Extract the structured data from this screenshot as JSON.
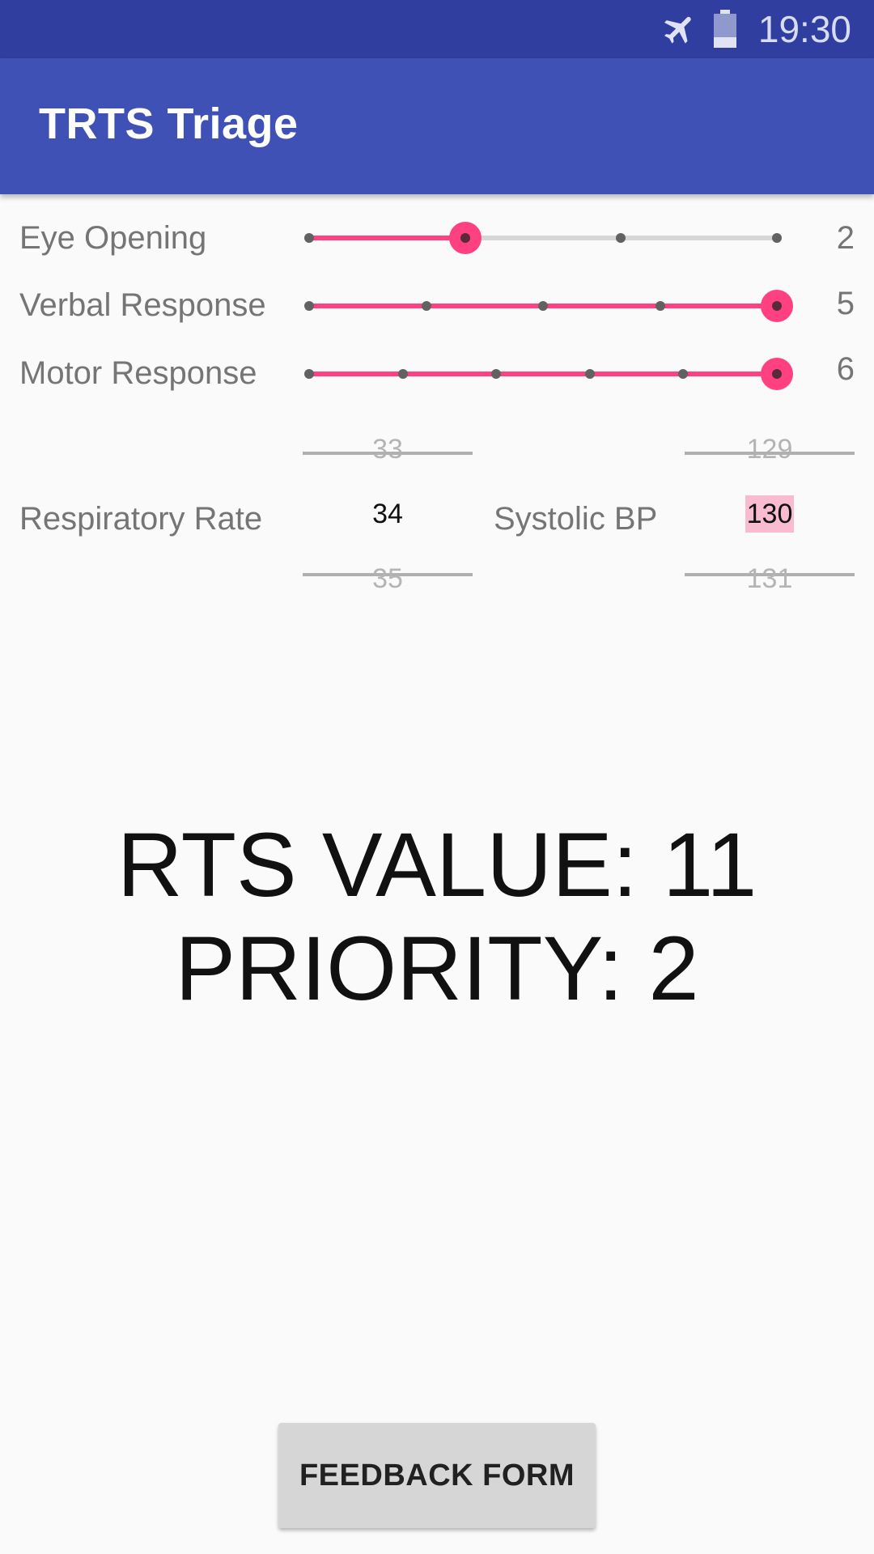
{
  "status_bar": {
    "time": "19:30",
    "icons": [
      "airplane-mode-icon",
      "battery-icon"
    ],
    "background": "#303f9f"
  },
  "app_bar": {
    "title": "TRTS Triage",
    "background": "#3f51b5"
  },
  "accent_color": "#ff4081",
  "sliders": [
    {
      "label": "Eye Opening",
      "value": "2",
      "min": 1,
      "max": 4,
      "current": 2
    },
    {
      "label": "Verbal Response",
      "value": "5",
      "min": 1,
      "max": 5,
      "current": 5
    },
    {
      "label": "Motor Response",
      "value": "6",
      "min": 1,
      "max": 6,
      "current": 6
    }
  ],
  "respiratory_rate": {
    "label": "Respiratory Rate",
    "prev": "33",
    "current": "34",
    "next": "35"
  },
  "systolic_bp": {
    "label": "Systolic BP",
    "prev": "129",
    "current": "130",
    "next": "131"
  },
  "result": {
    "rts_line": "RTS VALUE: 11",
    "priority_line": "PRIORITY: 2"
  },
  "feedback_button": {
    "label": "FEEDBACK FORM"
  }
}
